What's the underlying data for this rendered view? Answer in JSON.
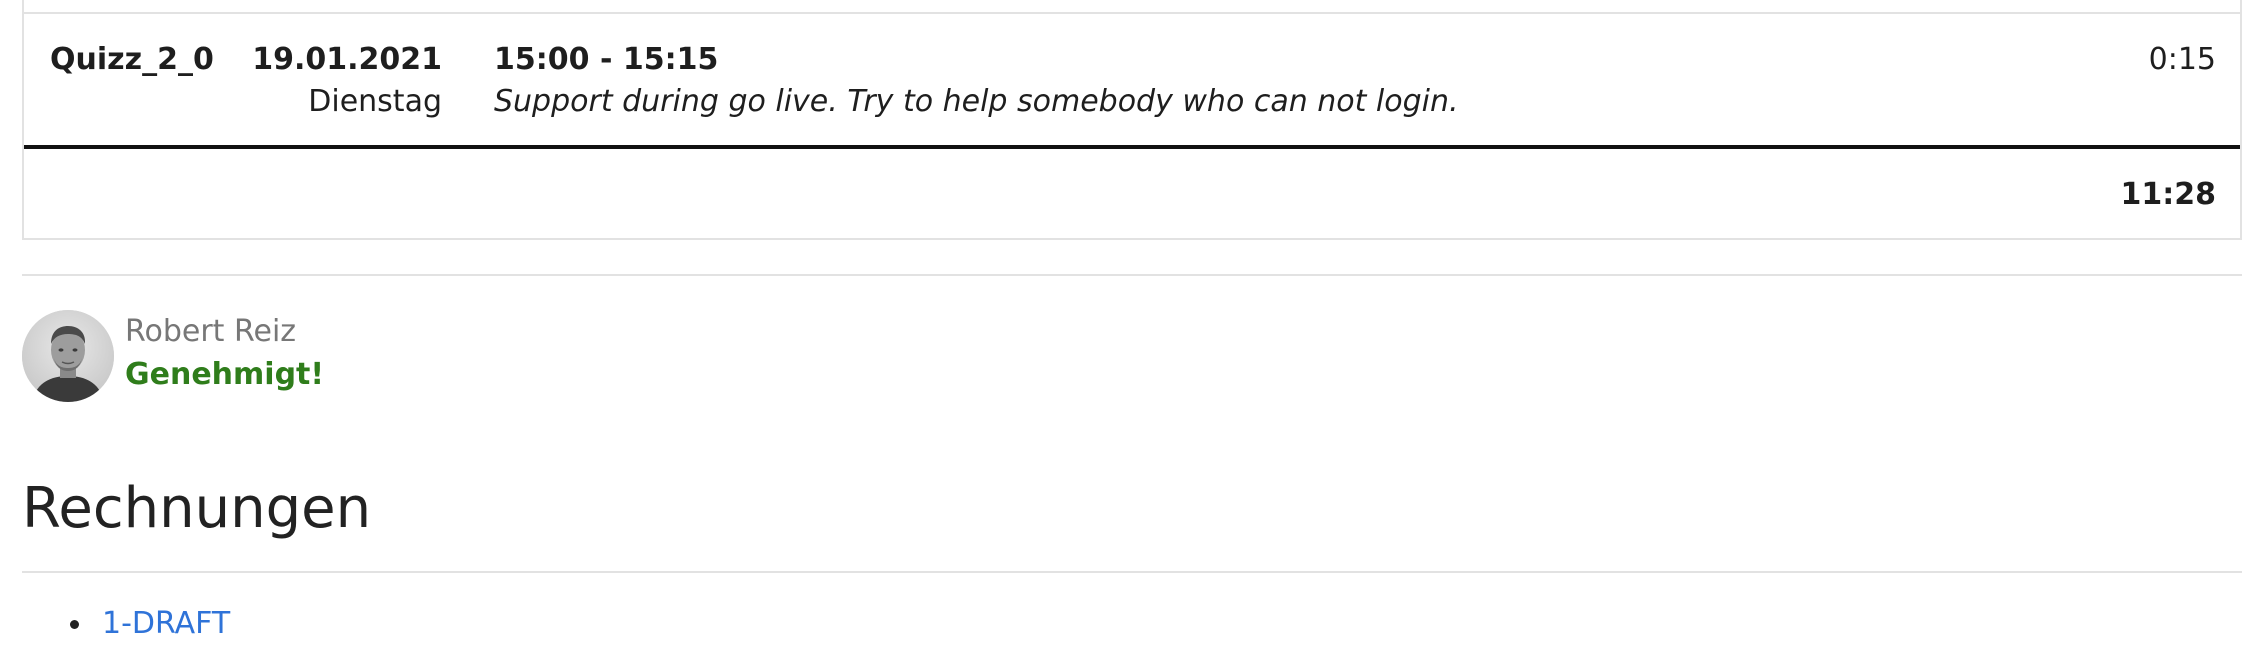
{
  "entry": {
    "project": "Quizz_2_0",
    "date": "19.01.2021",
    "weekday": "Dienstag",
    "time_range": "15:00 - 15:15",
    "description": "Support during go live. Try to help somebody who can not login.",
    "duration": "0:15"
  },
  "summary": {
    "total": "11:28"
  },
  "approval": {
    "approver_name": "Robert Reiz",
    "status": "Genehmigt!",
    "status_color": "#2f7d1b"
  },
  "invoices": {
    "title": "Rechnungen",
    "items": [
      {
        "label": "1-DRAFT"
      }
    ],
    "link_color": "#2f73d8"
  }
}
